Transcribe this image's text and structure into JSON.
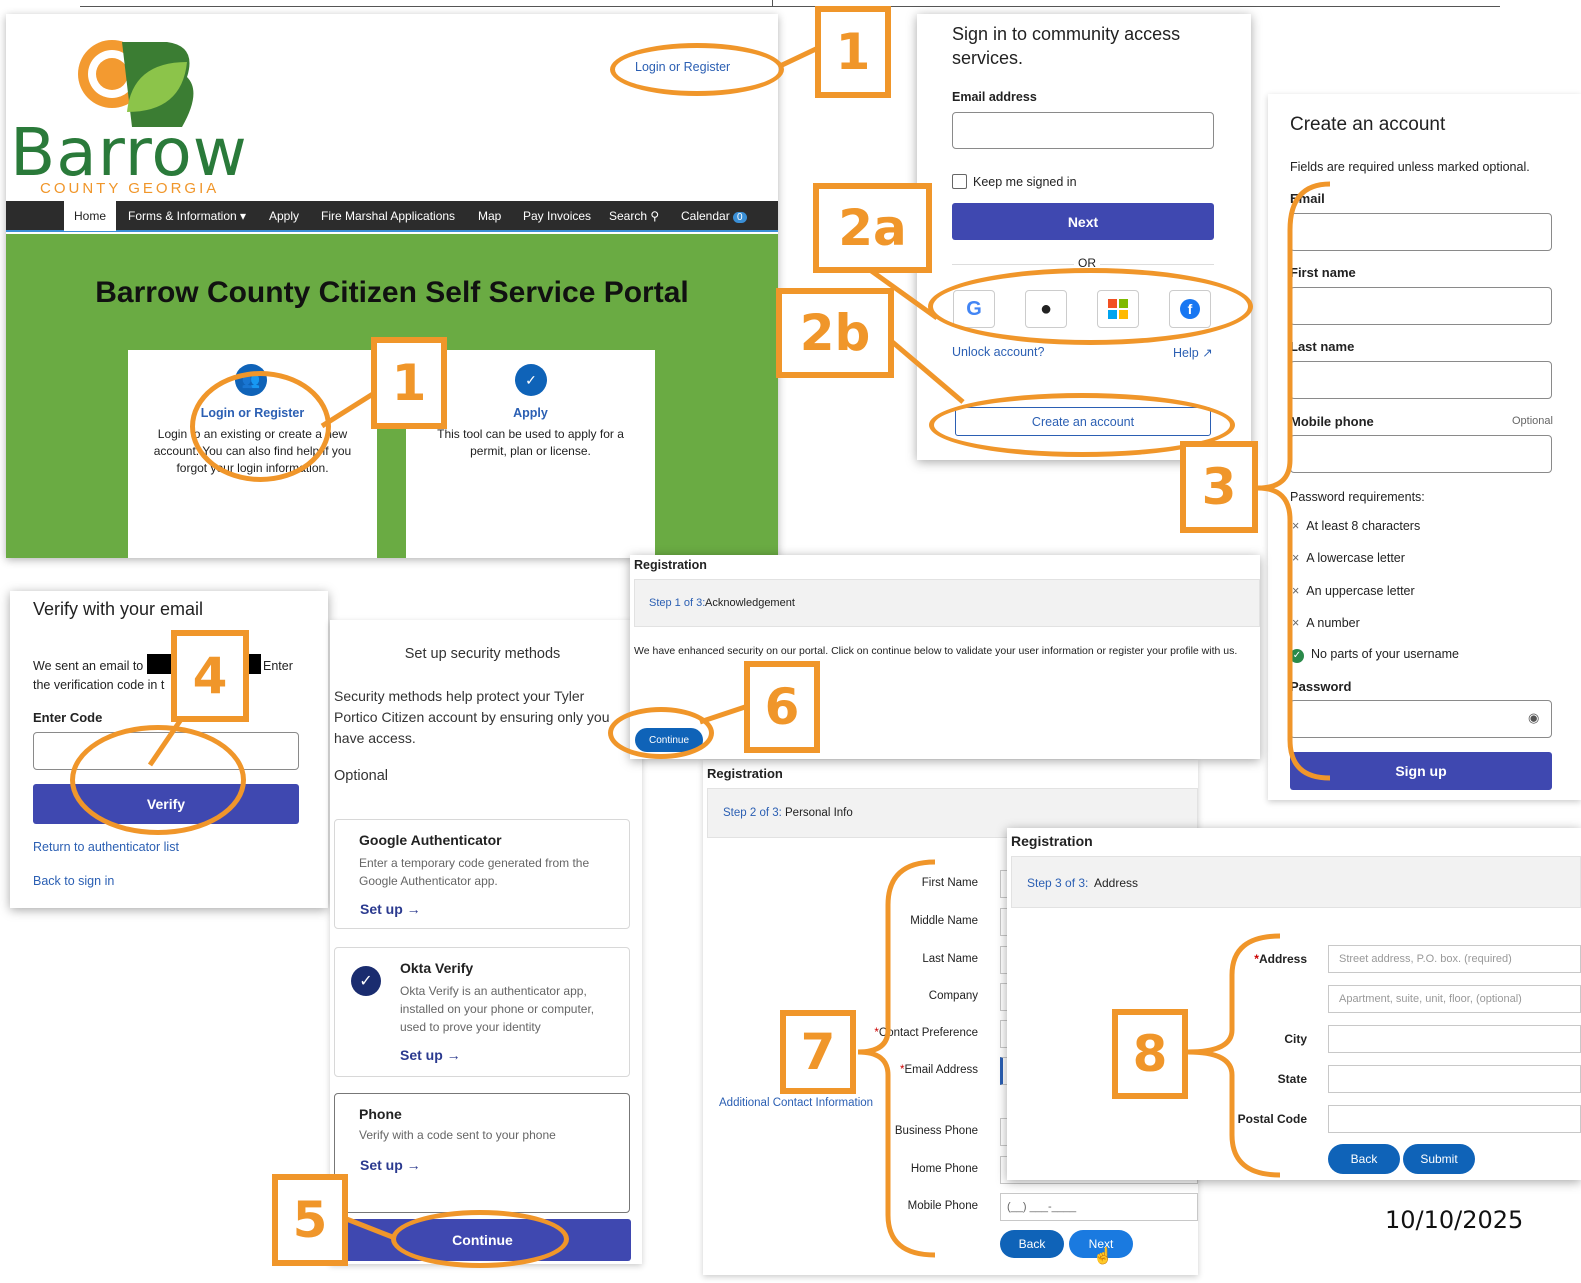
{
  "colors": {
    "orange": "#f0962a",
    "indigo": "#3f48b0",
    "green": "#6aab43",
    "blue": "#0f63b8",
    "navbar": "#2c2c2c"
  },
  "barrow": {
    "logo_word": "Barrow",
    "logo_sub": "COUNTY GEORGIA",
    "top_link": "Login or Register",
    "nav": [
      "Home",
      "Forms & Information",
      "Apply",
      "Fire Marshal Applications",
      "Map",
      "Pay Invoices",
      "Search",
      "Calendar"
    ],
    "calendar_badge": "0",
    "title": "Barrow County Citizen Self Service Portal",
    "card1_title": "Login or Register",
    "card1_text": "Login to an existing or create a new account. You can also find help if you forgot your login information.",
    "card2_title": "Apply",
    "card2_text": "This tool can be used to apply for a permit, plan or license."
  },
  "signin": {
    "title": "Sign in to community access services.",
    "email_label": "Email address",
    "keep_signed": "Keep me signed in",
    "next": "Next",
    "or": "OR",
    "unlock": "Unlock account?",
    "help": "Help",
    "create": "Create an account"
  },
  "create": {
    "title": "Create an account",
    "note": "Fields are required unless marked optional.",
    "email": "Email",
    "first": "First name",
    "last": "Last name",
    "mobile": "Mobile phone",
    "optional": "Optional",
    "pw_req": "Password requirements:",
    "reqs": [
      "At least 8 characters",
      "A lowercase letter",
      "An uppercase letter",
      "A number",
      "No parts of your username"
    ],
    "password": "Password",
    "signup": "Sign up"
  },
  "verify": {
    "title": "Verify with your email",
    "sent_a": "We sent an email to",
    "sent_b": "Enter",
    "sent_c": "the verification code in t",
    "enter_code": "Enter Code",
    "verify_btn": "Verify",
    "return": "Return to authenticator list",
    "back": "Back to sign in"
  },
  "security": {
    "title": "Set up security methods",
    "desc": "Security methods help protect your Tyler Portico Citizen account by ensuring only you have access.",
    "optional": "Optional",
    "ga_title": "Google Authenticator",
    "ga_desc": "Enter a temporary code generated from the Google Authenticator app.",
    "setup": "Set up",
    "okta_title": "Okta Verify",
    "okta_desc": "Okta Verify is an authenticator app, installed on your phone or computer, used to prove your identity",
    "phone_title": "Phone",
    "phone_desc": "Verify with a code sent to your phone",
    "continue": "Continue"
  },
  "reg1": {
    "heading": "Registration",
    "step": "Step 1 of 3:",
    "step_name": "Acknowledgement",
    "text": "We have enhanced security on our portal. Click on continue below to validate your user information or register your profile with us.",
    "continue": "Continue"
  },
  "reg2": {
    "heading": "Registration",
    "step": "Step 2 of 3:",
    "step_name": "Personal Info",
    "fields": [
      "First Name",
      "Middle Name",
      "Last Name",
      "Company",
      "Contact Preference",
      "Email Address",
      "Business Phone",
      "Home Phone",
      "Mobile Phone"
    ],
    "additional": "Additional Contact Information",
    "mobile_mask": "(__) ___-____",
    "back": "Back",
    "next": "Next"
  },
  "reg3": {
    "heading": "Registration",
    "step": "Step 3 of 3:",
    "step_name": "Address",
    "address": "Address",
    "addr_ph": "Street address, P.O. box. (required)",
    "addr2_ph": "Apartment, suite, unit, floor, (optional)",
    "city": "City",
    "state": "State",
    "postal": "Postal Code",
    "back": "Back",
    "submit": "Submit"
  },
  "callouts": [
    "1",
    "1",
    "2a",
    "2b",
    "3",
    "4",
    "5",
    "6",
    "7",
    "8"
  ],
  "date": "10/10/2025"
}
